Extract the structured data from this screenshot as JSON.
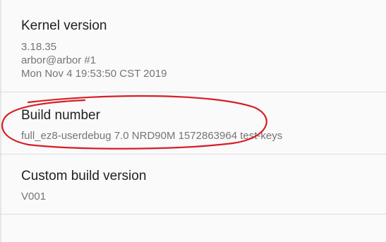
{
  "settings": {
    "kernel": {
      "title": "Kernel version",
      "lines": [
        "3.18.35",
        "arbor@arbor #1",
        "Mon Nov 4 19:53:50 CST 2019"
      ]
    },
    "build": {
      "title": "Build number",
      "summary": "full_ez8-userdebug 7.0 NRD90M 1572863964 test-keys"
    },
    "custom": {
      "title": "Custom build version",
      "summary": "V001"
    }
  },
  "colors": {
    "title_text": "#212121",
    "summary_text": "#757575",
    "divider": "#dedede",
    "annotation": "#d81e26"
  }
}
